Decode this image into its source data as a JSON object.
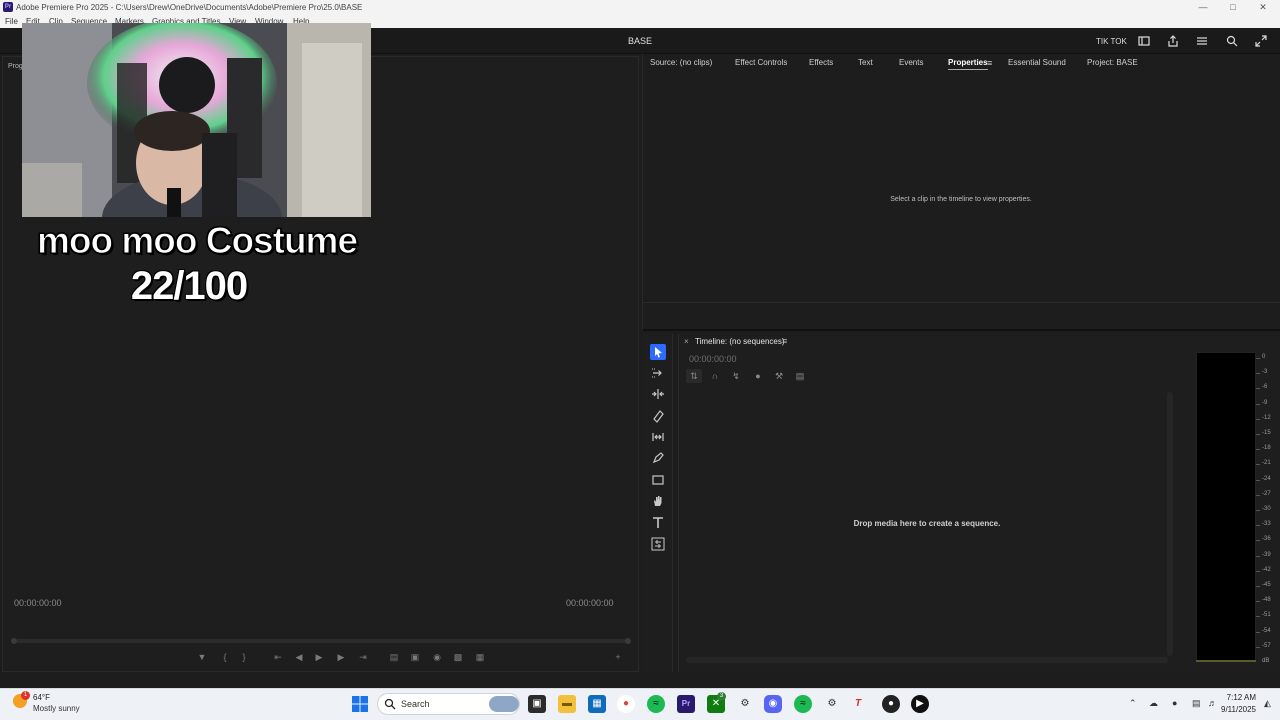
{
  "window": {
    "title": "Adobe Premiere Pro 2025 - C:\\Users\\Drew\\OneDrive\\Documents\\Adobe\\Premiere Pro\\25.0\\BASE",
    "logo": "Pr"
  },
  "menu": {
    "items": [
      "File",
      "Edit",
      "Clip",
      "Sequence",
      "Markers",
      "Graphics and Titles",
      "View",
      "Window",
      "Help"
    ]
  },
  "header": {
    "project_name": "BASE",
    "workspace": "TIK TOK"
  },
  "program_monitor": {
    "tab_label": "Prog",
    "timecode_left": "00:00:00:00",
    "timecode_right": "00:00:00:00"
  },
  "overlay": {
    "caption_line1": "moo moo Costume",
    "caption_line2": "22/100"
  },
  "properties_panel": {
    "tabs": [
      "Source: (no clips)",
      "Effect Controls",
      "Effects",
      "Text",
      "Events",
      "Properties",
      "Essential Sound",
      "Project: BASE"
    ],
    "active_tab": "Properties",
    "message": "Select a clip in the timeline to view properties."
  },
  "tools": [
    "selection-tool",
    "track-select-tool",
    "ripple-edit-tool",
    "razor-tool",
    "slip-tool",
    "pen-tool",
    "rectangle-tool",
    "hand-tool",
    "type-tool",
    "remix-tool"
  ],
  "timeline": {
    "title": "Timeline: (no sequences)",
    "timecode": "00:00:00:00",
    "drop_message": "Drop media here to create a sequence."
  },
  "audio_meter": {
    "scale": [
      "0",
      "-3",
      "-6",
      "-9",
      "-12",
      "-15",
      "-18",
      "-21",
      "-24",
      "-27",
      "-30",
      "-33",
      "-36",
      "-39",
      "-42",
      "-45",
      "-48",
      "-51",
      "-54",
      "-57",
      "dB"
    ]
  },
  "taskbar": {
    "weather_temp": "64°F",
    "weather_desc": "Mostly sunny",
    "weather_badge": "1",
    "search_placeholder": "Search",
    "time": "7:12 AM",
    "date": "9/11/2025",
    "xbox_badge": "3"
  }
}
